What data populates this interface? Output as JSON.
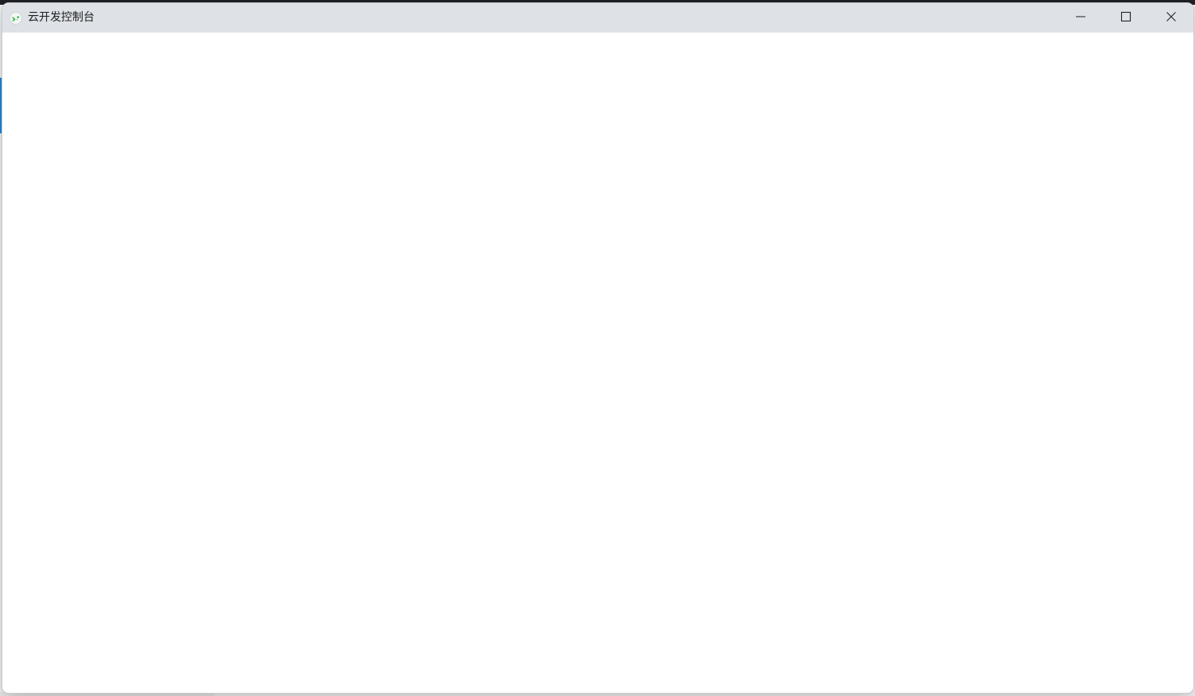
{
  "window": {
    "title": "云开发控制台",
    "icon": "cloud-dev-console-icon",
    "controls": {
      "minimize_icon": "minimize-icon",
      "maximize_icon": "maximize-icon",
      "close_icon": "close-icon"
    }
  },
  "colors": {
    "titlebar_bg": "#dee1e6",
    "content_bg": "#ffffff",
    "icon_accent": "#2db84d"
  }
}
